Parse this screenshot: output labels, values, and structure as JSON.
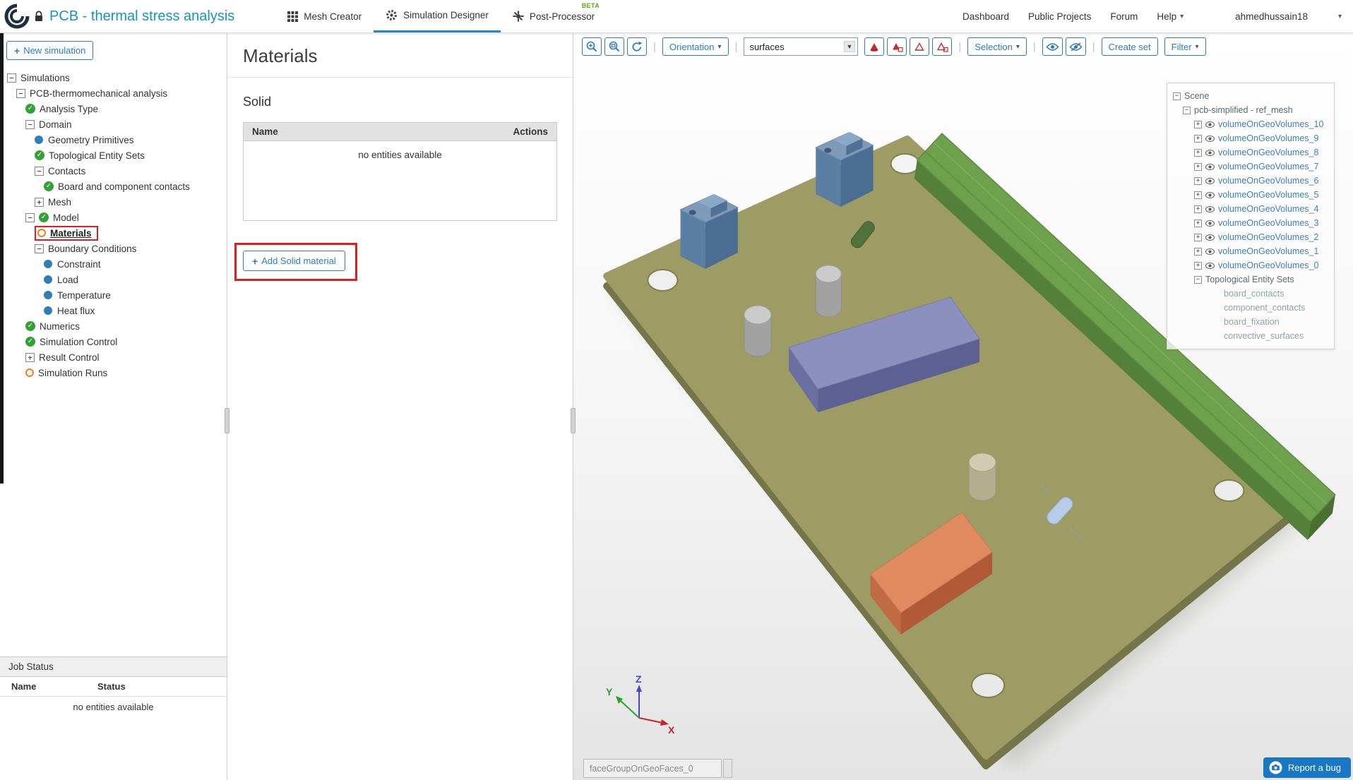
{
  "colors": {
    "brand_teal": "#1695ba",
    "accent_blue": "#2e7cb8",
    "link_blue": "#3f7fbe",
    "highlight_red": "#e01e1e",
    "status_green": "#33a136",
    "status_orange": "#e8821e",
    "dot_blue": "#2d7fb5",
    "beta_green": "#63a416"
  },
  "navbar": {
    "project_title": "PCB - thermal stress analysis",
    "tabs": [
      {
        "label": "Mesh Creator"
      },
      {
        "label": "Simulation Designer"
      },
      {
        "label": "Post-Processor",
        "badge": "BETA"
      }
    ],
    "links": [
      "Dashboard",
      "Public Projects",
      "Forum",
      "Help"
    ],
    "username": "ahmedhussain18"
  },
  "sidebar": {
    "new_simulation_label": "New simulation",
    "tree": [
      {
        "label": "Simulations",
        "level": 0,
        "expander": "minus"
      },
      {
        "label": "PCB-thermomechanical analysis",
        "level": 1,
        "expander": "minus"
      },
      {
        "label": "Analysis Type",
        "level": 2,
        "icon": "check"
      },
      {
        "label": "Domain",
        "level": 2,
        "expander": "minus"
      },
      {
        "label": "Geometry Primitives",
        "level": 3,
        "icon": "dot"
      },
      {
        "label": "Topological Entity Sets",
        "level": 3,
        "icon": "check"
      },
      {
        "label": "Contacts",
        "level": 3,
        "expander": "minus"
      },
      {
        "label": "Board and component contacts",
        "level": 4,
        "icon": "check"
      },
      {
        "label": "Mesh",
        "level": 3,
        "expander": "plus"
      },
      {
        "label": "Model",
        "level": 2,
        "expander": "minus",
        "icon": "check"
      },
      {
        "label": "Materials",
        "level": 3,
        "icon": "ring",
        "selected": true
      },
      {
        "label": "Boundary Conditions",
        "level": 3,
        "expander": "minus"
      },
      {
        "label": "Constraint",
        "level": 4,
        "icon": "dot"
      },
      {
        "label": "Load",
        "level": 4,
        "icon": "dot"
      },
      {
        "label": "Temperature",
        "level": 4,
        "icon": "dot"
      },
      {
        "label": "Heat flux",
        "level": 4,
        "icon": "dot"
      },
      {
        "label": "Numerics",
        "level": 2,
        "icon": "check"
      },
      {
        "label": "Simulation Control",
        "level": 2,
        "icon": "check"
      },
      {
        "label": "Result Control",
        "level": 2,
        "expander": "plus"
      },
      {
        "label": "Simulation Runs",
        "level": 2,
        "icon": "ring"
      }
    ],
    "job_status": {
      "title": "Job Status",
      "columns": [
        "Name",
        "Status"
      ],
      "empty_text": "no entities available"
    }
  },
  "materials_panel": {
    "title": "Materials",
    "section_title": "Solid",
    "table": {
      "columns": [
        "Name",
        "Actions"
      ],
      "empty_text": "no entities available"
    },
    "add_button_label": "Add Solid material"
  },
  "viewport": {
    "toolbar": {
      "orientation_label": "Orientation",
      "render_mode_value": "surfaces",
      "selection_label": "Selection",
      "create_set_label": "Create set",
      "filter_label": "Filter"
    },
    "scene_tree": {
      "root_label": "Scene",
      "mesh_label": "pcb-simplified - ref_mesh",
      "volumes": [
        "volumeOnGeoVolumes_10",
        "volumeOnGeoVolumes_9",
        "volumeOnGeoVolumes_8",
        "volumeOnGeoVolumes_7",
        "volumeOnGeoVolumes_6",
        "volumeOnGeoVolumes_5",
        "volumeOnGeoVolumes_4",
        "volumeOnGeoVolumes_3",
        "volumeOnGeoVolumes_2",
        "volumeOnGeoVolumes_1",
        "volumeOnGeoVolumes_0"
      ],
      "entity_sets_label": "Topological Entity Sets",
      "entity_sets": [
        "board_contacts",
        "component_contacts",
        "board_fixation",
        "convective_surfaces"
      ]
    },
    "axis_labels": {
      "x": "X",
      "y": "Y",
      "z": "Z"
    },
    "face_group_value": "faceGroupOnGeoFaces_0",
    "report_bug_label": "Report a bug"
  }
}
